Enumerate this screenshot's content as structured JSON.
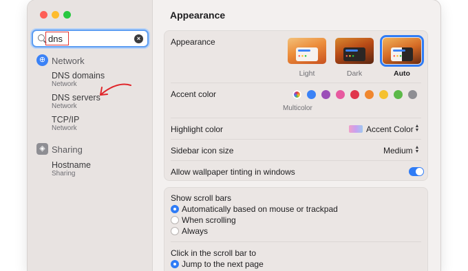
{
  "window": {
    "title": "Appearance"
  },
  "sidebar": {
    "search": {
      "value": "dns"
    },
    "sections": [
      {
        "label": "Network",
        "icon": "globe-icon",
        "results": [
          {
            "title": "DNS domains",
            "sub": "Network"
          },
          {
            "title": "DNS servers",
            "sub": "Network"
          },
          {
            "title": "TCP/IP",
            "sub": "Network"
          }
        ]
      },
      {
        "label": "Sharing",
        "icon": "sharing-icon",
        "results": [
          {
            "title": "Hostname",
            "sub": "Sharing"
          }
        ]
      }
    ]
  },
  "main": {
    "appearance": {
      "label": "Appearance",
      "options": [
        {
          "label": "Light",
          "selected": false
        },
        {
          "label": "Dark",
          "selected": false
        },
        {
          "label": "Auto",
          "selected": true
        }
      ]
    },
    "accent": {
      "label": "Accent color",
      "multicolor_label": "Multicolor",
      "colors": [
        "#3b82f6",
        "#9b4fb8",
        "#e75aa0",
        "#e0354b",
        "#f0872e",
        "#f5c12e",
        "#5cb948",
        "#8e8e93"
      ]
    },
    "highlight": {
      "label": "Highlight color",
      "value": "Accent Color"
    },
    "sidebar_icon_size": {
      "label": "Sidebar icon size",
      "value": "Medium"
    },
    "wallpaper_tinting": {
      "label": "Allow wallpaper tinting in windows",
      "on": true
    },
    "scroll_bars": {
      "label": "Show scroll bars",
      "options": [
        {
          "label": "Automatically based on mouse or trackpad",
          "selected": true
        },
        {
          "label": "When scrolling",
          "selected": false
        },
        {
          "label": "Always",
          "selected": false
        }
      ]
    },
    "click_scroll": {
      "label": "Click in the scroll bar to",
      "options": [
        {
          "label": "Jump to the next page",
          "selected": true
        }
      ]
    }
  }
}
